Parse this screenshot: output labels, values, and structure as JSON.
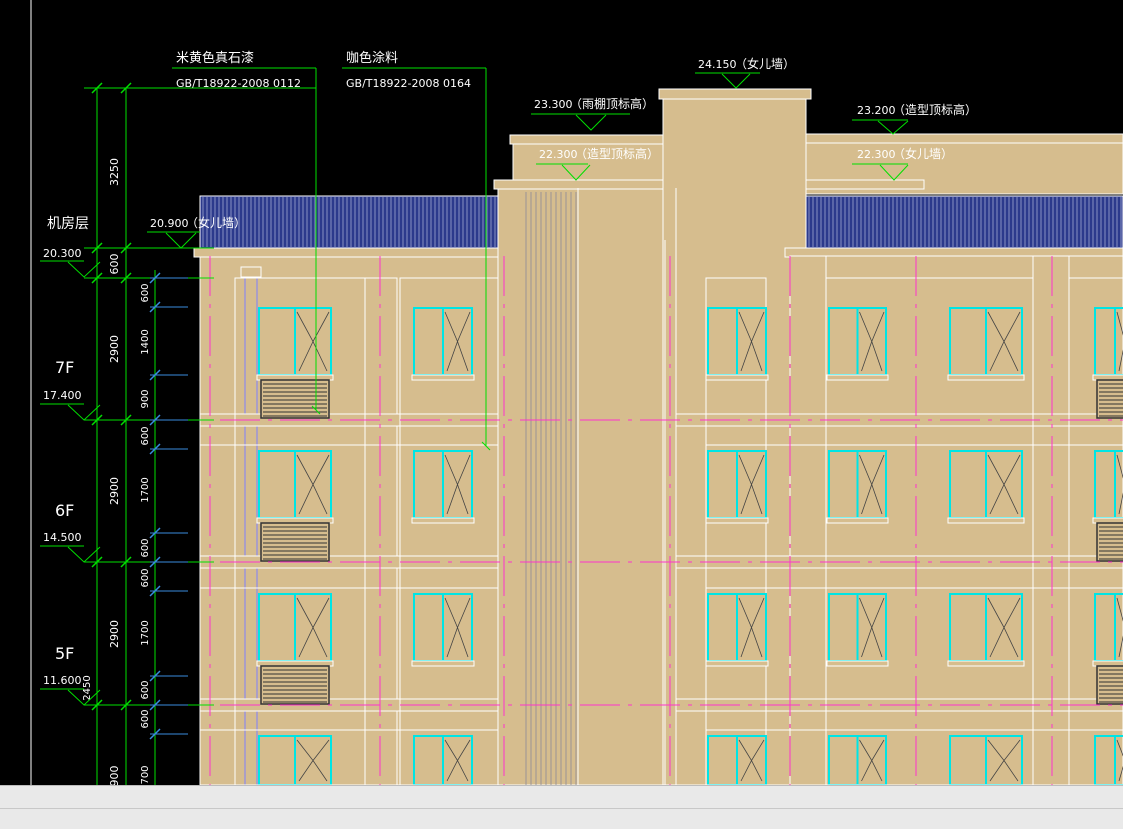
{
  "colors": {
    "background": "#000000",
    "wall": "#d6bd8e",
    "outline": "#ffffff",
    "dimension": "#00e000",
    "leader": "#00e000",
    "axis": "#ff33cc",
    "window_glass": "#00e5e5",
    "railing": "#2c3a8c",
    "grid_tick": "#3a8dde",
    "status_bg": "#e9e9e9"
  },
  "materials": [
    {
      "name": "米黄色真石漆",
      "code": "GB/T18922-2008 0112"
    },
    {
      "name": "咖色涂料",
      "code": "GB/T18922-2008 0164"
    }
  ],
  "floors": [
    {
      "label": "机房层",
      "elevation": "20.300"
    },
    {
      "label": "7F",
      "elevation": "17.400"
    },
    {
      "label": "6F",
      "elevation": "14.500"
    },
    {
      "label": "5F",
      "elevation": "11.600"
    }
  ],
  "elevation_labels": [
    {
      "value": "24.150",
      "desc": "（女儿墙）"
    },
    {
      "value": "23.300",
      "desc": "（雨棚顶标高）"
    },
    {
      "value": "23.200",
      "desc": "（造型顶标高）"
    },
    {
      "value": "22.300",
      "desc": "（造型顶标高）"
    },
    {
      "value": "22.300",
      "desc": "（女儿墙）"
    },
    {
      "value": "20.900",
      "desc": "（女儿墙）"
    }
  ],
  "outer_dimensions": [
    "3250",
    "600",
    "2900",
    "2900",
    "2900",
    "900"
  ],
  "inner_dimensions": [
    "600",
    "1400",
    "900",
    "600",
    "1700",
    "600",
    "600",
    "1700",
    "600",
    "600",
    "700"
  ],
  "small_dimension": "2450"
}
